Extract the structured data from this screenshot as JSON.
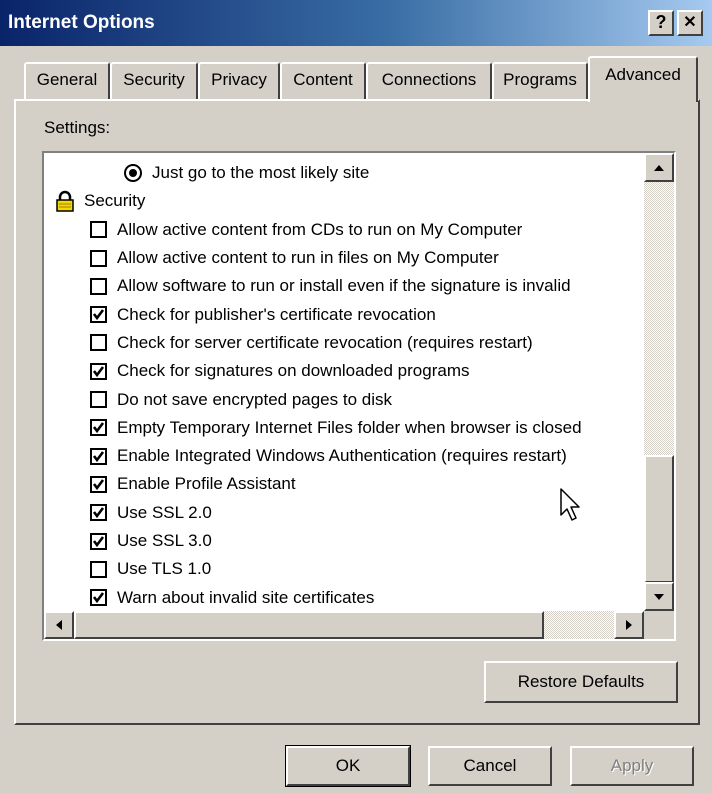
{
  "window": {
    "title": "Internet Options",
    "help_label": "?",
    "close_label": "✕"
  },
  "tabs": [
    {
      "label": "General"
    },
    {
      "label": "Security"
    },
    {
      "label": "Privacy"
    },
    {
      "label": "Content"
    },
    {
      "label": "Connections"
    },
    {
      "label": "Programs"
    },
    {
      "label": "Advanced"
    }
  ],
  "active_tab": "Advanced",
  "settings": {
    "label": "Settings:",
    "items": [
      {
        "type": "radio",
        "label": "Just go to the most likely site",
        "checked": true
      },
      {
        "type": "group",
        "label": "Security",
        "icon": "lock-icon"
      },
      {
        "type": "checkbox",
        "label": "Allow active content from CDs to run on My Computer",
        "checked": false
      },
      {
        "type": "checkbox",
        "label": "Allow active content to run in files on My Computer",
        "checked": false
      },
      {
        "type": "checkbox",
        "label": "Allow software to run or install even if the signature is invalid",
        "checked": false
      },
      {
        "type": "checkbox",
        "label": "Check for publisher's certificate revocation",
        "checked": true
      },
      {
        "type": "checkbox",
        "label": "Check for server certificate revocation (requires restart)",
        "checked": false
      },
      {
        "type": "checkbox",
        "label": "Check for signatures on downloaded programs",
        "checked": true
      },
      {
        "type": "checkbox",
        "label": "Do not save encrypted pages to disk",
        "checked": false
      },
      {
        "type": "checkbox",
        "label": "Empty Temporary Internet Files folder when browser is closed",
        "checked": true
      },
      {
        "type": "checkbox",
        "label": "Enable Integrated Windows Authentication (requires restart)",
        "checked": true
      },
      {
        "type": "checkbox",
        "label": "Enable Profile Assistant",
        "checked": true
      },
      {
        "type": "checkbox",
        "label": "Use SSL 2.0",
        "checked": true
      },
      {
        "type": "checkbox",
        "label": "Use SSL 3.0",
        "checked": true
      },
      {
        "type": "checkbox",
        "label": "Use TLS 1.0",
        "checked": false
      },
      {
        "type": "checkbox",
        "label": "Warn about invalid site certificates",
        "checked": true
      }
    ]
  },
  "buttons": {
    "restore_defaults": "Restore Defaults",
    "ok": "OK",
    "cancel": "Cancel",
    "apply": "Apply"
  },
  "colors": {
    "title_bar": "#0a246a",
    "face": "#d4d0c8",
    "disabled_text": "#808080"
  }
}
